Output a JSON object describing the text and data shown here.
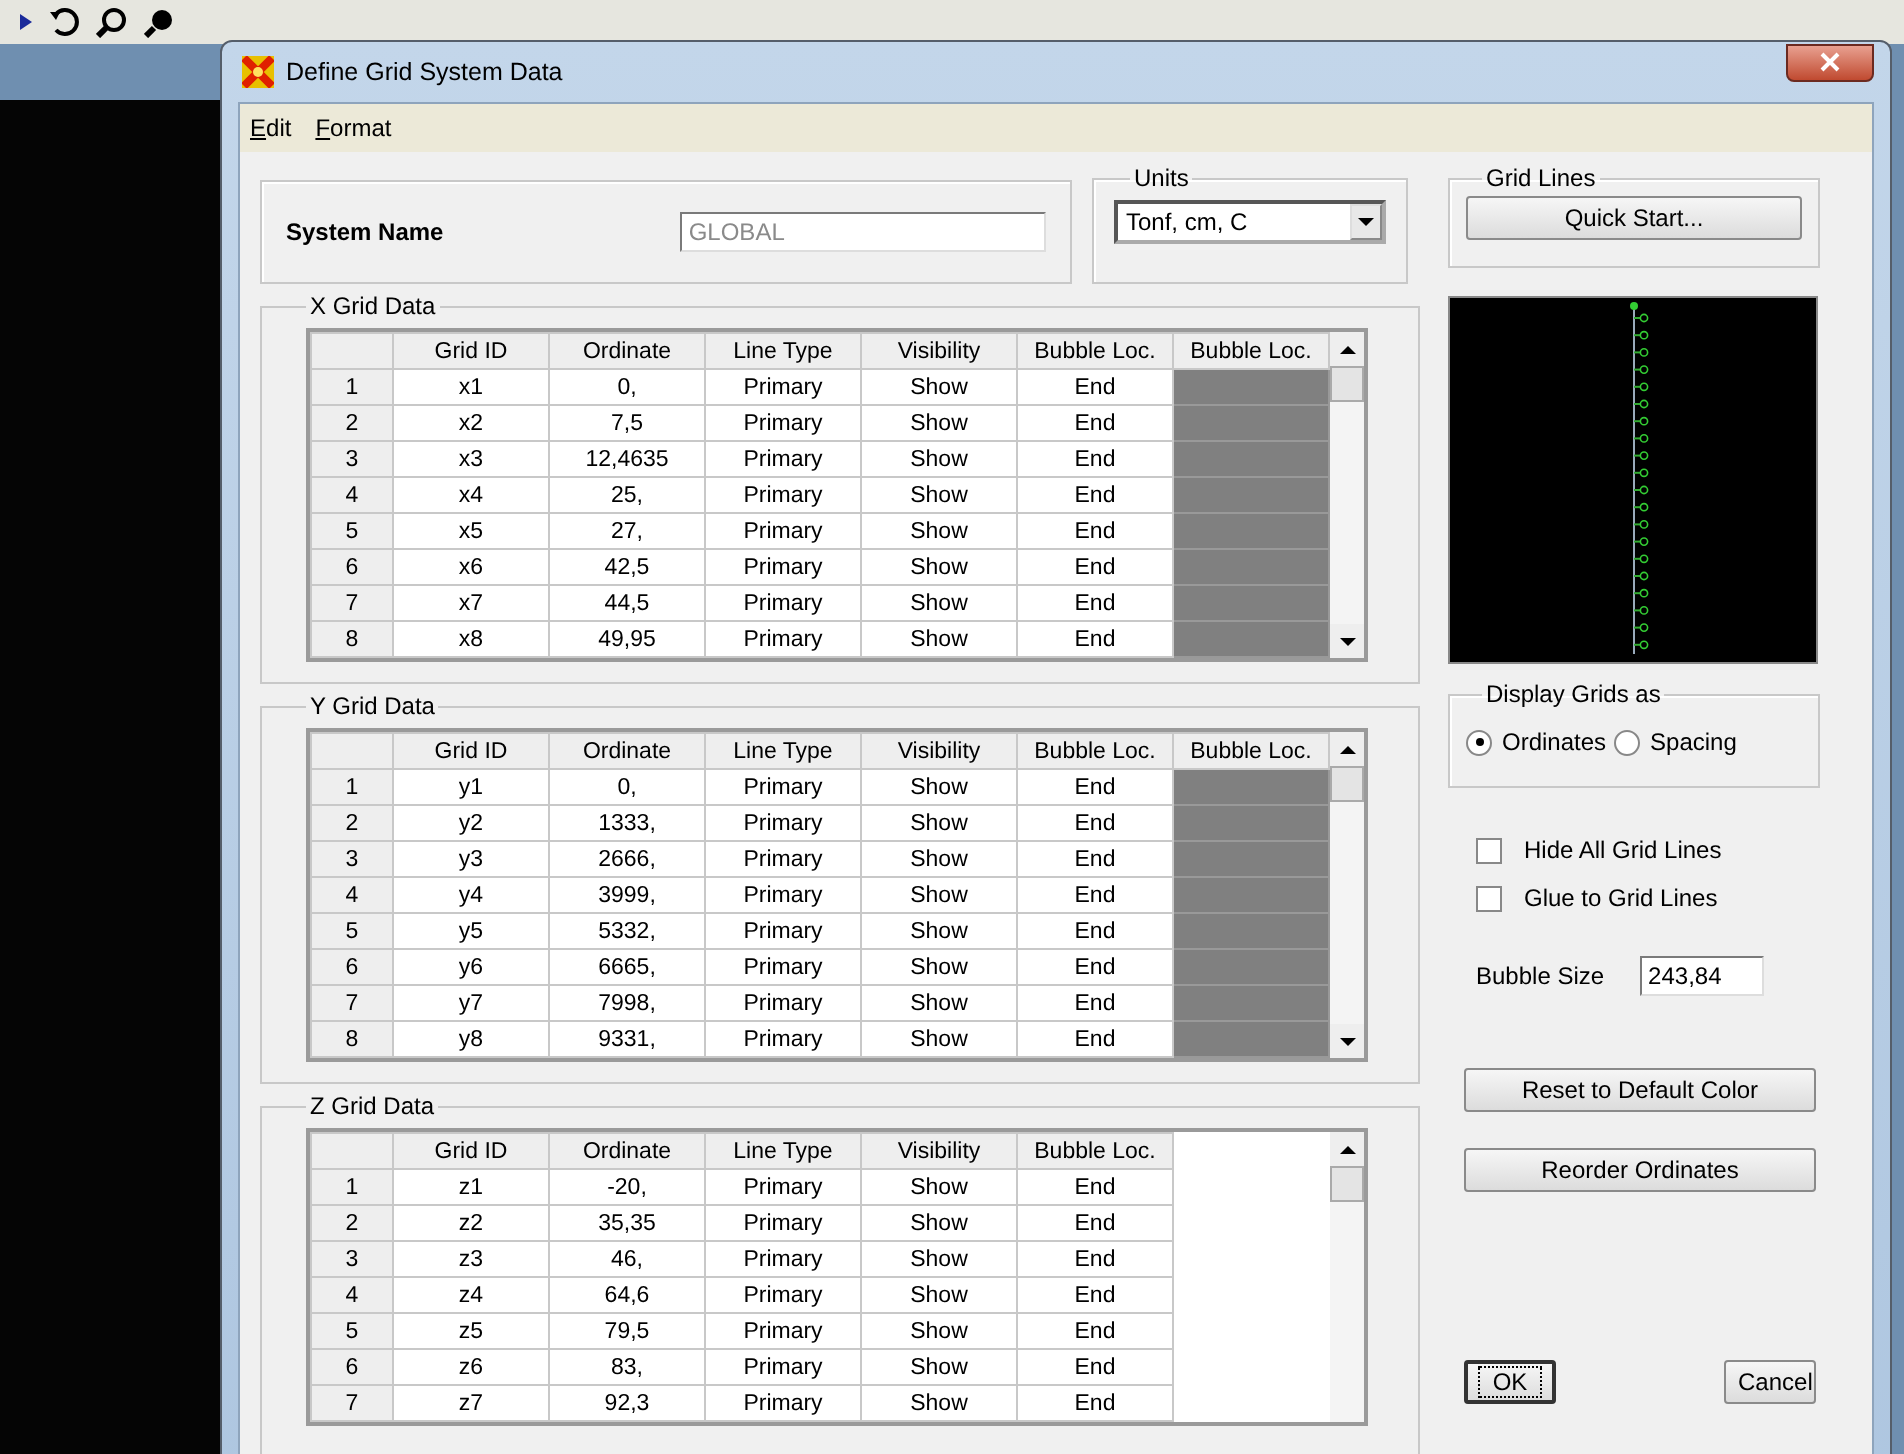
{
  "window": {
    "title": "Define Grid System Data"
  },
  "menu": [
    "Edit",
    "Format"
  ],
  "system_name": {
    "label": "System Name",
    "value": "GLOBAL",
    "disabled": true
  },
  "units": {
    "label": "Units",
    "value": "Tonf, cm, C"
  },
  "grids": [
    {
      "title": "X Grid Data",
      "columns": [
        "Grid ID",
        "Ordinate",
        "Line Type",
        "Visibility",
        "Bubble Loc.",
        "Bubble Loc."
      ],
      "rows": [
        {
          "number": "1",
          "cells": [
            "x1",
            "0,",
            "Primary",
            "Show",
            "End"
          ],
          "color": "#808080"
        },
        {
          "number": "2",
          "cells": [
            "x2",
            "7,5",
            "Primary",
            "Show",
            "End"
          ],
          "color": "#808080"
        },
        {
          "number": "3",
          "cells": [
            "x3",
            "12,4635",
            "Primary",
            "Show",
            "End"
          ],
          "color": "#808080"
        },
        {
          "number": "4",
          "cells": [
            "x4",
            "25,",
            "Primary",
            "Show",
            "End"
          ],
          "color": "#808080"
        },
        {
          "number": "5",
          "cells": [
            "x5",
            "27,",
            "Primary",
            "Show",
            "End"
          ],
          "color": "#808080"
        },
        {
          "number": "6",
          "cells": [
            "x6",
            "42,5",
            "Primary",
            "Show",
            "End"
          ],
          "color": "#808080"
        },
        {
          "number": "7",
          "cells": [
            "x7",
            "44,5",
            "Primary",
            "Show",
            "End"
          ],
          "color": "#808080"
        },
        {
          "number": "8",
          "cells": [
            "x8",
            "49,95",
            "Primary",
            "Show",
            "End"
          ],
          "color": "#808080"
        }
      ]
    },
    {
      "title": "Y Grid Data",
      "columns": [
        "Grid ID",
        "Ordinate",
        "Line Type",
        "Visibility",
        "Bubble Loc.",
        "Bubble Loc."
      ],
      "rows": [
        {
          "number": "1",
          "cells": [
            "y1",
            "0,",
            "Primary",
            "Show",
            "End"
          ],
          "color": "#808080"
        },
        {
          "number": "2",
          "cells": [
            "y2",
            "1333,",
            "Primary",
            "Show",
            "End"
          ],
          "color": "#808080"
        },
        {
          "number": "3",
          "cells": [
            "y3",
            "2666,",
            "Primary",
            "Show",
            "End"
          ],
          "color": "#808080"
        },
        {
          "number": "4",
          "cells": [
            "y4",
            "3999,",
            "Primary",
            "Show",
            "End"
          ],
          "color": "#808080"
        },
        {
          "number": "5",
          "cells": [
            "y5",
            "5332,",
            "Primary",
            "Show",
            "End"
          ],
          "color": "#808080"
        },
        {
          "number": "6",
          "cells": [
            "y6",
            "6665,",
            "Primary",
            "Show",
            "End"
          ],
          "color": "#808080"
        },
        {
          "number": "7",
          "cells": [
            "y7",
            "7998,",
            "Primary",
            "Show",
            "End"
          ],
          "color": "#808080"
        },
        {
          "number": "8",
          "cells": [
            "y8",
            "9331,",
            "Primary",
            "Show",
            "End"
          ],
          "color": "#808080"
        }
      ]
    },
    {
      "title": "Z Grid Data",
      "columns": [
        "Grid ID",
        "Ordinate",
        "Line Type",
        "Visibility",
        "Bubble Loc."
      ],
      "rows": [
        {
          "number": "1",
          "cells": [
            "z1",
            "-20,",
            "Primary",
            "Show",
            "End"
          ]
        },
        {
          "number": "2",
          "cells": [
            "z2",
            "35,35",
            "Primary",
            "Show",
            "End"
          ]
        },
        {
          "number": "3",
          "cells": [
            "z3",
            "46,",
            "Primary",
            "Show",
            "End"
          ]
        },
        {
          "number": "4",
          "cells": [
            "z4",
            "64,6",
            "Primary",
            "Show",
            "End"
          ]
        },
        {
          "number": "5",
          "cells": [
            "z5",
            "79,5",
            "Primary",
            "Show",
            "End"
          ]
        },
        {
          "number": "6",
          "cells": [
            "z6",
            "83,",
            "Primary",
            "Show",
            "End"
          ]
        },
        {
          "number": "7",
          "cells": [
            "z7",
            "92,3",
            "Primary",
            "Show",
            "End"
          ]
        }
      ]
    }
  ],
  "grid_lines": {
    "title": "Grid Lines",
    "button": "Quick Start..."
  },
  "display": {
    "title": "Display Grids as",
    "options": [
      {
        "label": "Ordinates",
        "selected": true
      },
      {
        "label": "Spacing",
        "selected": false
      }
    ]
  },
  "checkboxes": [
    {
      "label": "Hide All Grid Lines",
      "checked": false
    },
    {
      "label": "Glue to Grid Lines",
      "checked": false
    }
  ],
  "bubble_size": {
    "label": "Bubble Size",
    "value": "243,84"
  },
  "buttons": [
    "Reset to Default Color",
    "Reorder Ordinates"
  ],
  "dialog_buttons": [
    {
      "label": "OK",
      "default": true
    },
    {
      "label": "Cancel",
      "default": false
    }
  ]
}
